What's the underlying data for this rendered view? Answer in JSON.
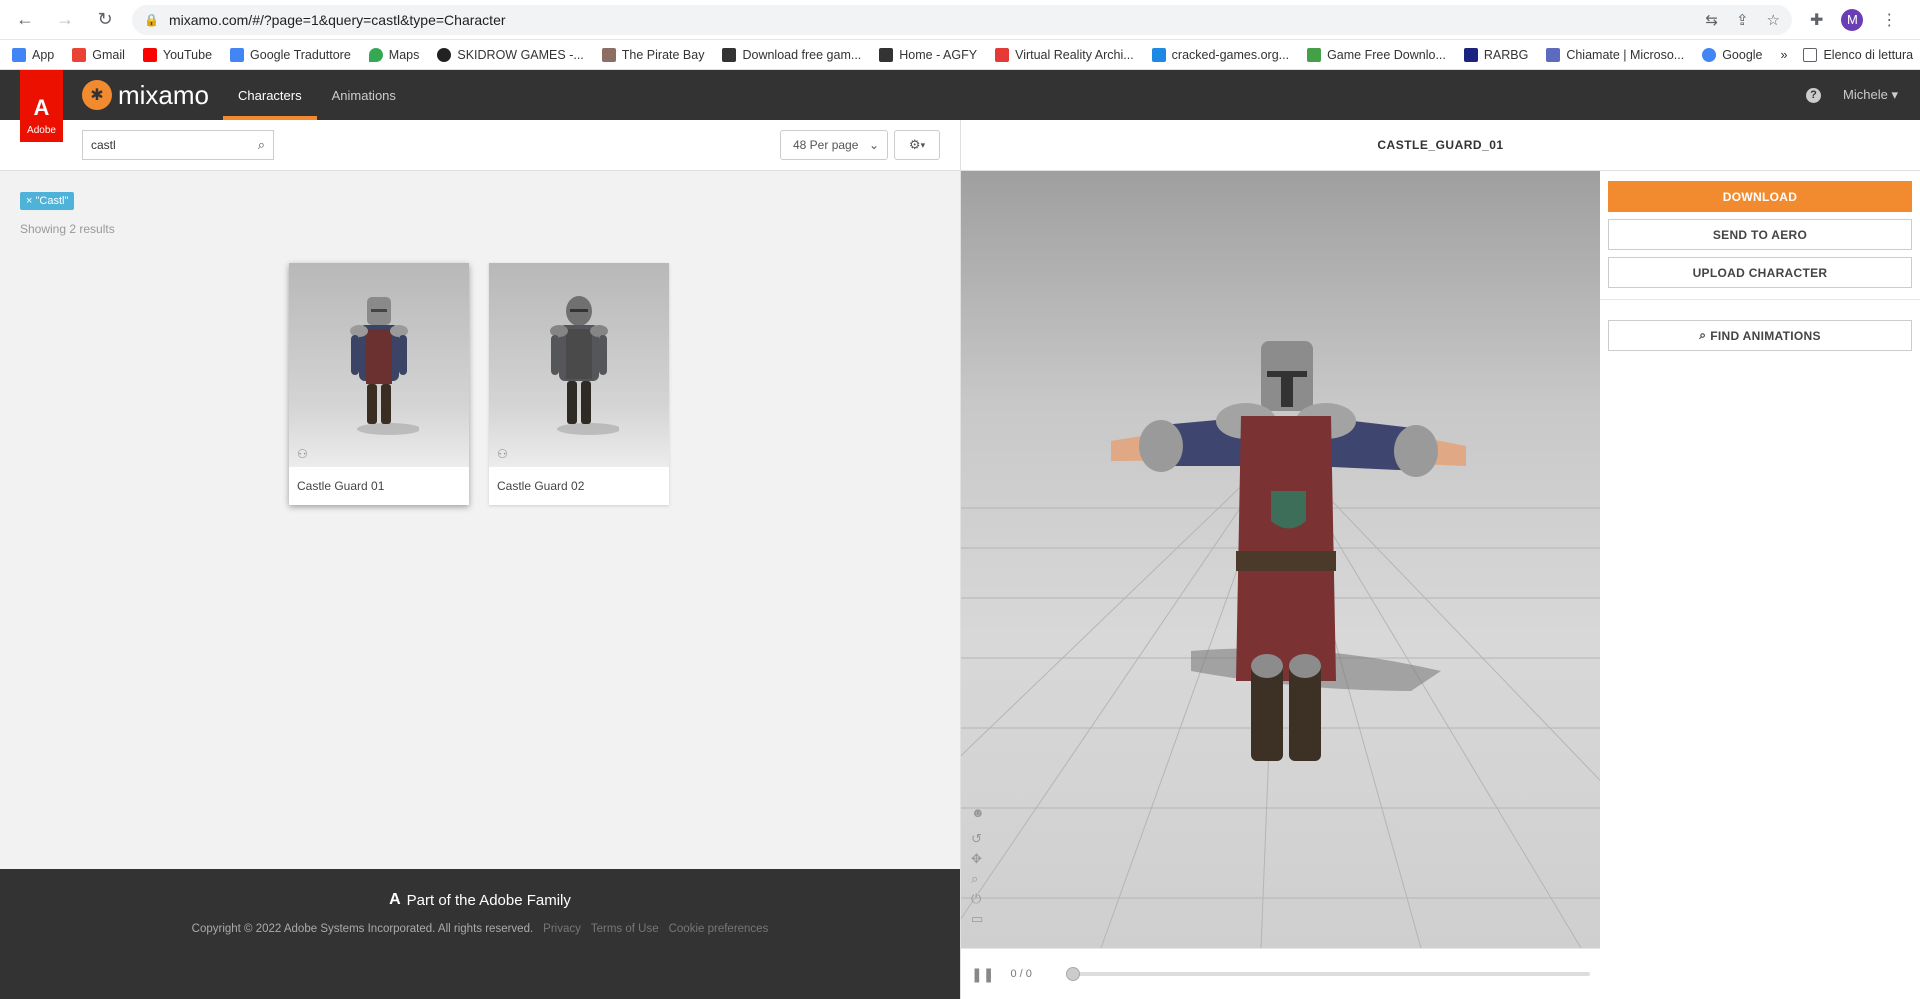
{
  "browser": {
    "url": "mixamo.com/#/?page=1&query=castl&type=Character",
    "avatar_letter": "M",
    "bookmarks": [
      {
        "label": "App",
        "color": "#4285f4"
      },
      {
        "label": "Gmail",
        "color": "#ea4335"
      },
      {
        "label": "YouTube",
        "color": "#ff0000"
      },
      {
        "label": "Google Traduttore",
        "color": "#4285f4"
      },
      {
        "label": "Maps",
        "color": "#34a853"
      },
      {
        "label": "SKIDROW GAMES -...",
        "color": "#222222"
      },
      {
        "label": "The Pirate Bay",
        "color": "#8d6e63"
      },
      {
        "label": "Download free gam...",
        "color": "#333333"
      },
      {
        "label": "Home - AGFY",
        "color": "#333333"
      },
      {
        "label": "Virtual Reality Archi...",
        "color": "#e53935"
      },
      {
        "label": "cracked-games.org...",
        "color": "#1e88e5"
      },
      {
        "label": "Game Free Downlo...",
        "color": "#43a047"
      },
      {
        "label": "RARBG",
        "color": "#1a237e"
      },
      {
        "label": "Chiamate | Microso...",
        "color": "#5c6bc0"
      },
      {
        "label": "Google",
        "color": "#4285f4"
      }
    ],
    "reading_list": "Elenco di lettura"
  },
  "header": {
    "adobe_label": "Adobe",
    "logo_text": "mixamo",
    "tabs": [
      {
        "label": "Characters",
        "active": true
      },
      {
        "label": "Animations",
        "active": false
      }
    ],
    "user_name": "Michele"
  },
  "toolbar": {
    "search_value": "castl",
    "per_page": "48 Per page"
  },
  "results": {
    "filter_tag": "× \"Castl\"",
    "count_text": "Showing 2 results",
    "cards": [
      {
        "name": "Castle Guard 01",
        "selected": true
      },
      {
        "name": "Castle Guard 02",
        "selected": false
      }
    ]
  },
  "footer": {
    "family": "Part of the Adobe Family",
    "copyright": "Copyright © 2022 Adobe Systems Incorporated. All rights reserved.",
    "links": [
      "Privacy",
      "Terms of Use",
      "Cookie preferences"
    ]
  },
  "viewer": {
    "title": "CASTLE_GUARD_01",
    "frames": "0 / 0",
    "buttons": {
      "download": "DOWNLOAD",
      "send_to_aero": "SEND TO AERO",
      "upload": "UPLOAD CHARACTER",
      "find_animations": "FIND ANIMATIONS"
    }
  },
  "colors": {
    "accent": "#f28b30",
    "adobe_red": "#eb1000",
    "tag_blue": "#4fb3d9",
    "header_bg": "#333333"
  }
}
